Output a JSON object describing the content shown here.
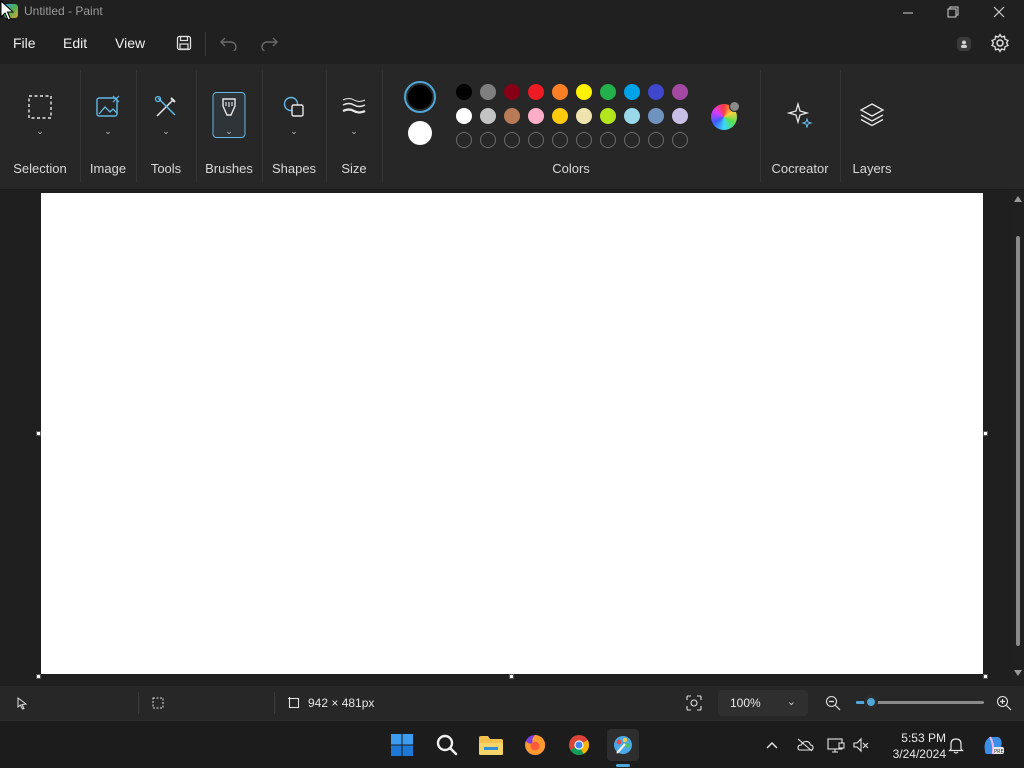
{
  "window": {
    "title": "Untitled - Paint",
    "controls": {
      "minimize_icon": "minimize-icon",
      "maximize_icon": "restore-icon",
      "close_icon": "close-icon"
    }
  },
  "menubar": {
    "items": [
      {
        "label": "File"
      },
      {
        "label": "Edit"
      },
      {
        "label": "View"
      }
    ]
  },
  "ribbon": {
    "groups": [
      {
        "label": "Selection",
        "icon": "selection-icon"
      },
      {
        "label": "Image",
        "icon": "image-icon"
      },
      {
        "label": "Tools",
        "icon": "tools-icon"
      },
      {
        "label": "Brushes",
        "icon": "brush-icon"
      },
      {
        "label": "Shapes",
        "icon": "shapes-icon"
      },
      {
        "label": "Size",
        "icon": "size-icon"
      },
      {
        "label": "Colors",
        "icon": "palette"
      },
      {
        "label": "Cocreator",
        "icon": "sparkle-icon"
      },
      {
        "label": "Layers",
        "icon": "layers-icon"
      }
    ],
    "colors": {
      "primary": "#000000",
      "secondary": "#ffffff",
      "palette_row1": [
        "#000000",
        "#7f7f7f",
        "#880015",
        "#ed1c24",
        "#ff7f27",
        "#fff200",
        "#22b14c",
        "#00a2e8",
        "#3f48cc",
        "#a349a4"
      ],
      "palette_row2": [
        "#ffffff",
        "#c3c3c3",
        "#b97a57",
        "#ffaec9",
        "#ffc90e",
        "#efe4b0",
        "#b5e61d",
        "#99d9ea",
        "#7092be",
        "#c8bfe7"
      ],
      "custom_slots": 10
    }
  },
  "canvas": {
    "background": "#ffffff"
  },
  "statusbar": {
    "dimensions": "942 × 481px",
    "zoom": "100%",
    "zoom_level_fraction": 0.12
  },
  "taskbar": {
    "apps": [
      "windows-start-icon",
      "search-icon",
      "file-explorer-icon",
      "firefox-icon",
      "chrome-icon",
      "paint-icon"
    ],
    "clock_time": "5:53 PM",
    "clock_date": "3/24/2024"
  }
}
